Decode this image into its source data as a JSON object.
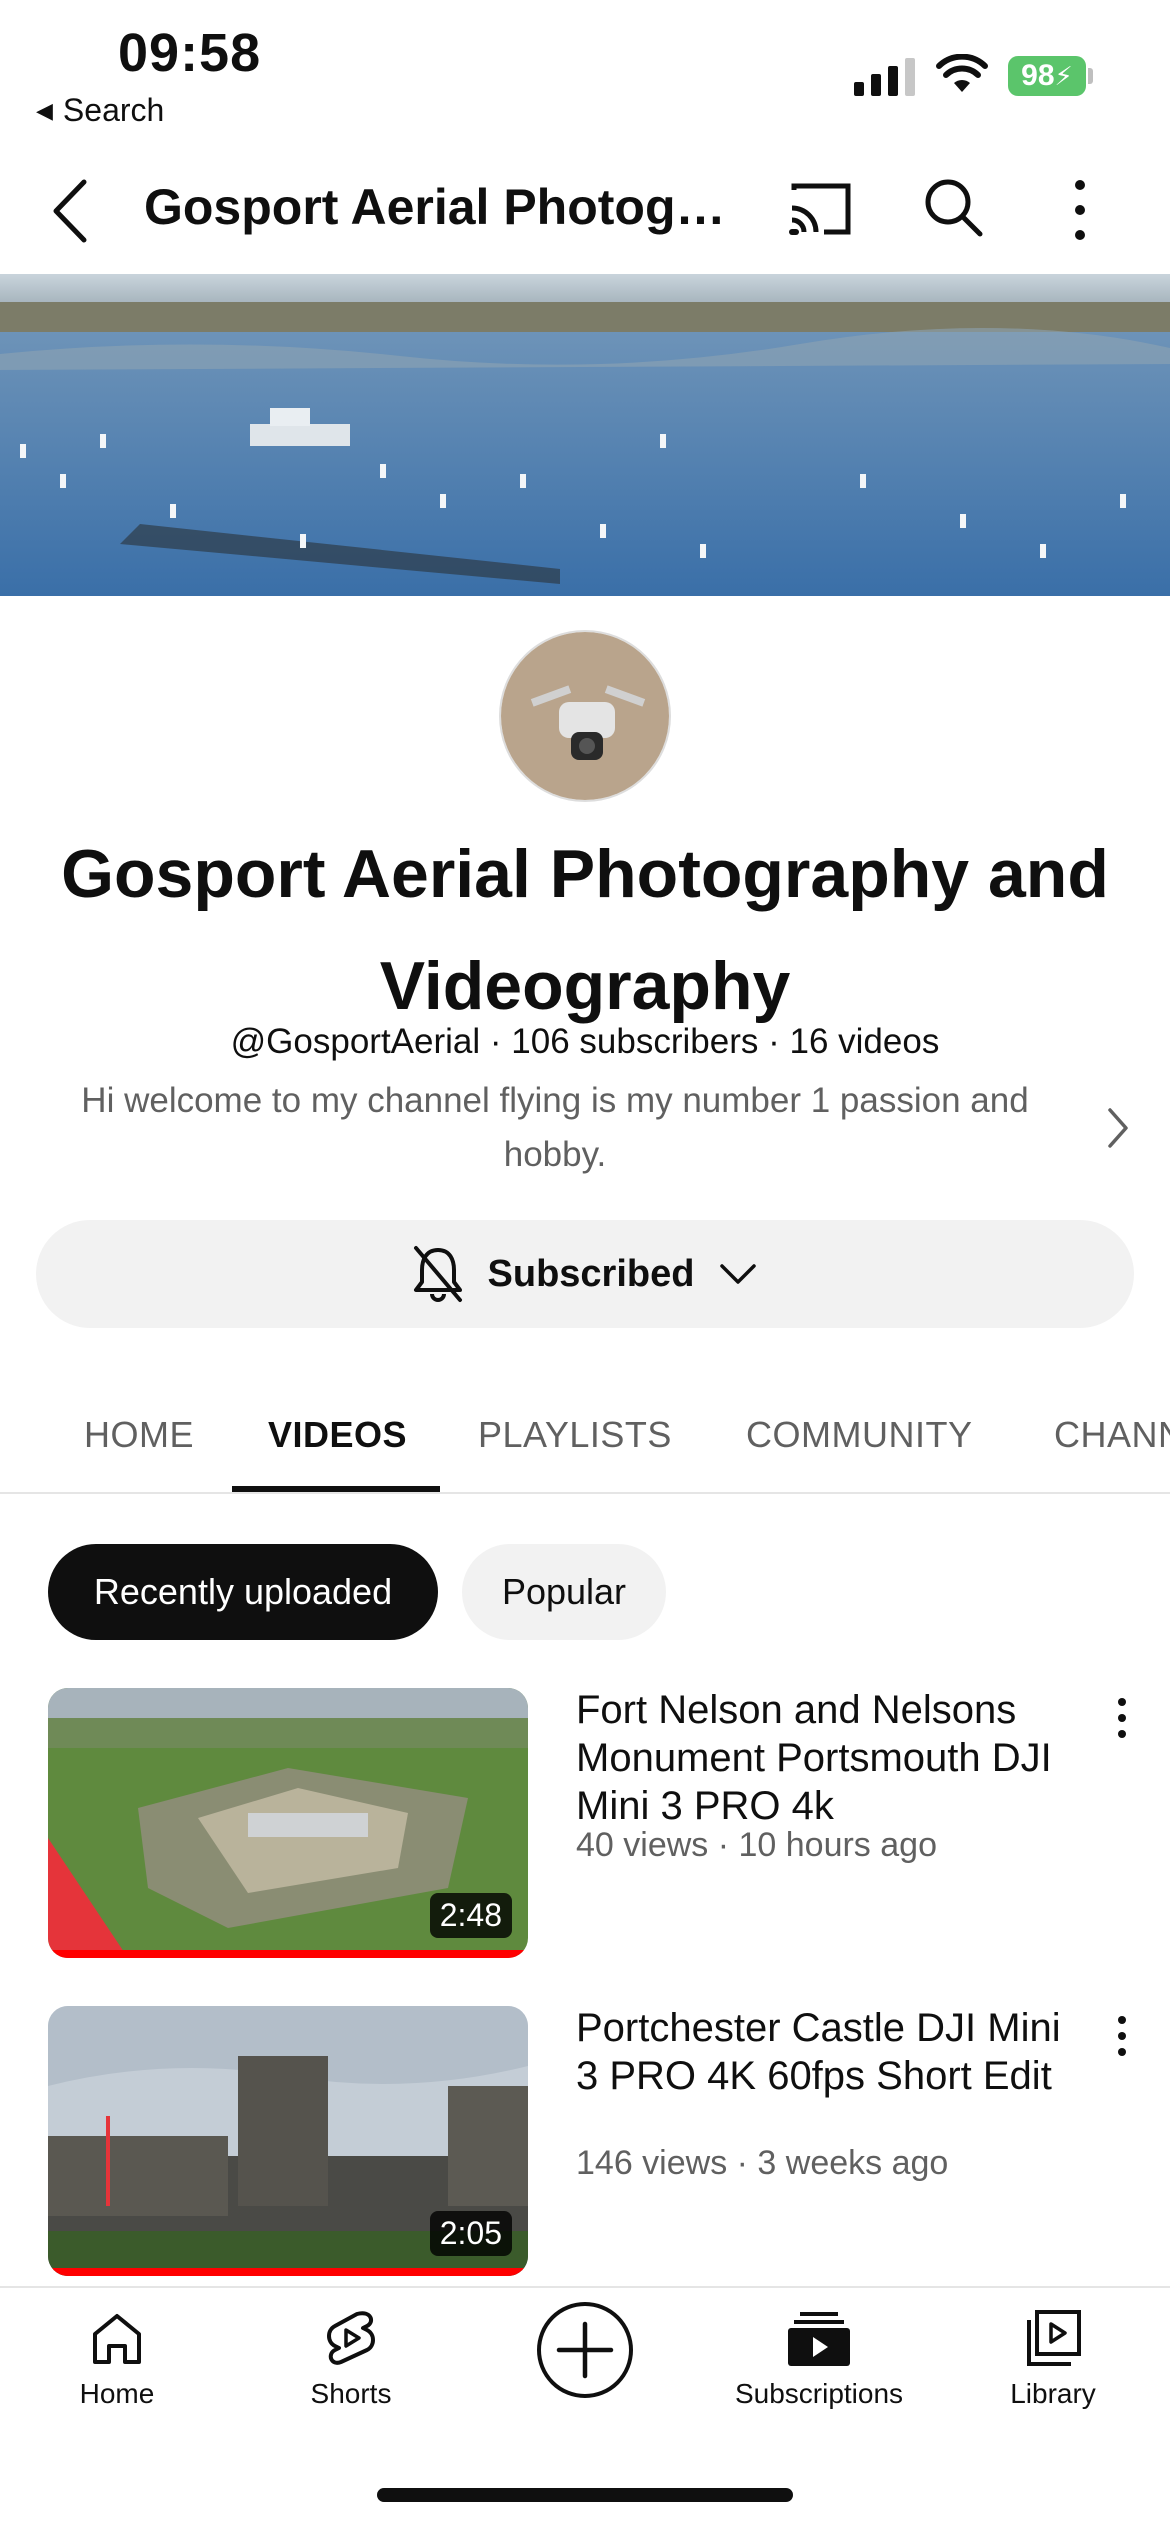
{
  "status": {
    "time": "09:58",
    "back_app": "Search",
    "battery": "98"
  },
  "header": {
    "title": "Gosport Aerial Photogra..."
  },
  "channel": {
    "name": "Gosport Aerial Photography and Videography",
    "handle": "@GosportAerial",
    "subscribers": "106 subscribers",
    "videos": "16 videos",
    "description": "Hi welcome to my channel flying is my number 1 passion and hobby.",
    "subscribe_label": "Subscribed"
  },
  "tabs": [
    {
      "label": "HOME"
    },
    {
      "label": "VIDEOS"
    },
    {
      "label": "PLAYLISTS"
    },
    {
      "label": "COMMUNITY"
    },
    {
      "label": "CHANNELS"
    }
  ],
  "filters": {
    "recent": "Recently uploaded",
    "popular": "Popular"
  },
  "videos": [
    {
      "title": "Fort Nelson and Nelsons Monument Portsmouth DJI Mini 3 PRO 4k",
      "meta": "40 views · 10 hours ago",
      "duration": "2:48",
      "watched": 1.0
    },
    {
      "title": "Portchester Castle DJI Mini 3 PRO 4K 60fps Short Edit",
      "meta": "146 views · 3 weeks ago",
      "duration": "2:05",
      "watched": 1.0
    }
  ],
  "nav": [
    {
      "label": "Home",
      "icon": "home-icon"
    },
    {
      "label": "Shorts",
      "icon": "shorts-icon"
    },
    {
      "label": "",
      "icon": "create-plus-icon"
    },
    {
      "label": "Subscriptions",
      "icon": "subscriptions-icon"
    },
    {
      "label": "Library",
      "icon": "library-icon"
    }
  ],
  "colors": {
    "accent": "#ff0000",
    "battery": "#5bc56b",
    "chip_active": "#0f0f0f"
  }
}
